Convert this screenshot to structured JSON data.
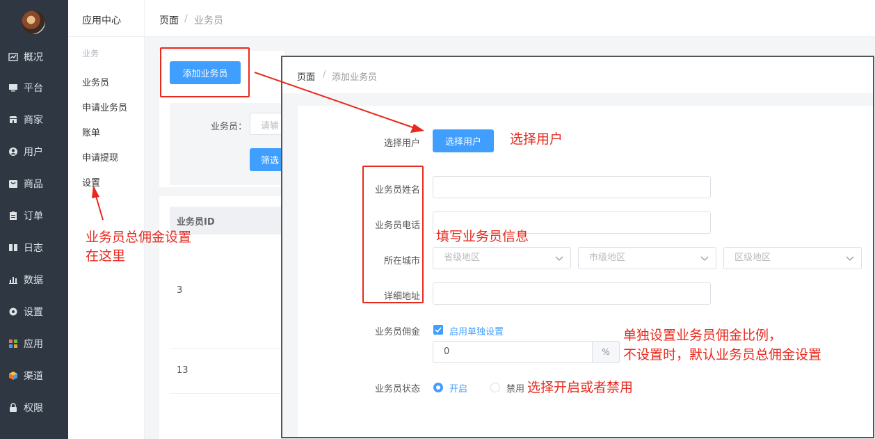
{
  "nav": {
    "items": [
      {
        "label": "概况",
        "icon": "chart-icon"
      },
      {
        "label": "平台",
        "icon": "monitor-icon"
      },
      {
        "label": "商家",
        "icon": "store-icon"
      },
      {
        "label": "用户",
        "icon": "user-icon"
      },
      {
        "label": "商品",
        "icon": "bag-icon"
      },
      {
        "label": "订单",
        "icon": "clipboard-icon"
      },
      {
        "label": "日志",
        "icon": "book-icon"
      },
      {
        "label": "数据",
        "icon": "bar-chart-icon"
      },
      {
        "label": "设置",
        "icon": "gear-icon"
      },
      {
        "label": "应用",
        "icon": "apps-icon"
      },
      {
        "label": "渠道",
        "icon": "cube-icon"
      },
      {
        "label": "权限",
        "icon": "lock-icon"
      }
    ]
  },
  "subnav": {
    "title": "应用中心",
    "group": "业务",
    "links": [
      "业务员",
      "申请业务员",
      "账单",
      "申请提现",
      "设置"
    ]
  },
  "breadcrumb": {
    "root": "页面",
    "sep": "/",
    "current": "业务员"
  },
  "list_page": {
    "add_button": "添加业务员",
    "filter_label": "业务员：",
    "filter_placeholder": "请输",
    "filter_button": "筛选",
    "table_header_id": "业务员ID",
    "rows": [
      "3",
      "13"
    ]
  },
  "panel": {
    "breadcrumb": {
      "root": "页面",
      "sep": "/",
      "current": "添加业务员"
    },
    "select_user_label": "选择用户",
    "select_user_button": "选择用户",
    "name_label": "业务员姓名",
    "phone_label": "业务员电话",
    "city_label": "所在城市",
    "province_placeholder": "省级地区",
    "city_placeholder": "市级地区",
    "district_placeholder": "区级地区",
    "address_label": "详细地址",
    "commission_label": "业务员佣金",
    "commission_checkbox": "启用单独设置",
    "commission_value": "0",
    "commission_unit": "%",
    "status_label": "业务员状态",
    "status_on": "开启",
    "status_off": "禁用"
  },
  "annotations": {
    "settings_note_1": "业务员总佣金设置",
    "settings_note_2": "在这里",
    "select_user_note": "选择用户",
    "info_note": "填写业务员信息",
    "commission_note_1": "单独设置业务员佣金比例，",
    "commission_note_2": "不设置时，默认业务员总佣金设置",
    "status_note": "选择开启或者禁用"
  },
  "colors": {
    "accent": "#409eff",
    "annotation": "#e8291d",
    "nav_bg": "#2f3742"
  }
}
